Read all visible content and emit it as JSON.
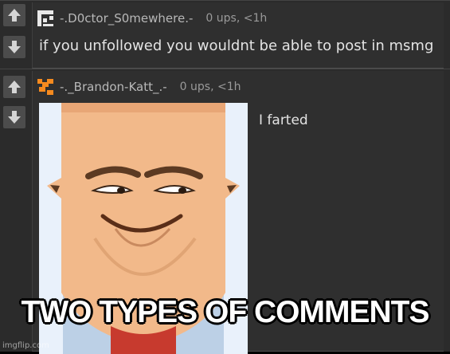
{
  "comments": [
    {
      "username": "-.D0ctor_S0mewhere.-",
      "stats": "0 ups, <1h",
      "text": "if you unfollowed you wouldnt be able to post in msmg",
      "avatar_icon": "white-pixel-pattern-icon",
      "avatar_color": "#e8e8e8",
      "upvote_icon": "arrow-up-icon",
      "downvote_icon": "arrow-down-icon"
    },
    {
      "username": "-._Brandon-Katt_.-",
      "stats": "0 ups, <1h",
      "text": "I farted",
      "avatar_icon": "orange-pixel-pattern-icon",
      "avatar_color": "#f58a1f",
      "upvote_icon": "arrow-up-icon",
      "downvote_icon": "arrow-down-icon"
    }
  ],
  "caption": "TWO TYPES OF COMMENTS",
  "watermark": "imgflip.com",
  "colors": {
    "background": "#2b2b2b",
    "vote_button": "#4c4c4c",
    "text": "#e3e3e3",
    "meta_text": "#a8a8a8"
  }
}
